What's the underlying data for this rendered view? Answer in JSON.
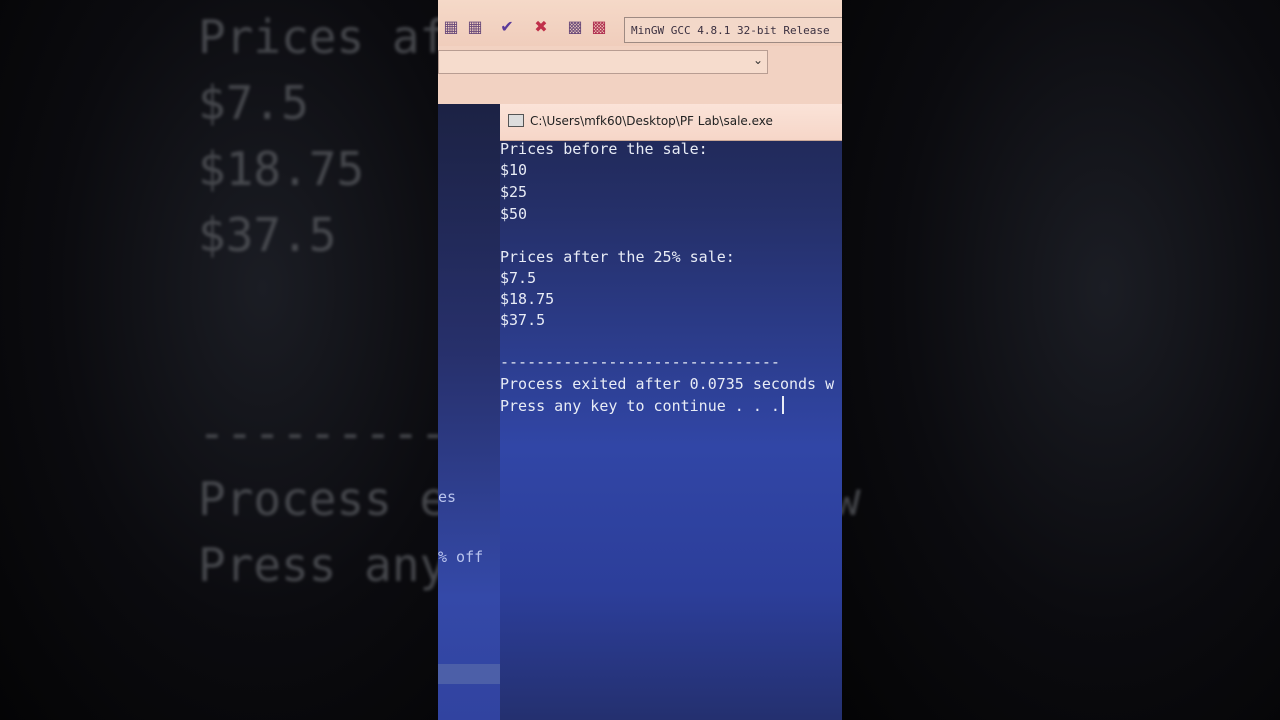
{
  "ide": {
    "compiler_label": "MinGW GCC 4.8.1 32-bit Release",
    "toolbar_icons": [
      "grid-icon",
      "grid-icon",
      "check-icon",
      "close-icon",
      "bar-chart-icon",
      "bar-chart-x-icon"
    ]
  },
  "side_pane": {
    "fragment_1": "es",
    "fragment_2": "% off"
  },
  "console": {
    "title": "C:\\Users\\mfk60\\Desktop\\PF Lab\\sale.exe",
    "lines": [
      "Prices before the sale:",
      "$10",
      "$25",
      "$50",
      "",
      "Prices after the 25% sale:",
      "$7.5",
      "$18.75",
      "$37.5",
      "",
      "-------------------------------",
      "Process exited after 0.0735 seconds w",
      "Press any key to continue . . ."
    ]
  }
}
